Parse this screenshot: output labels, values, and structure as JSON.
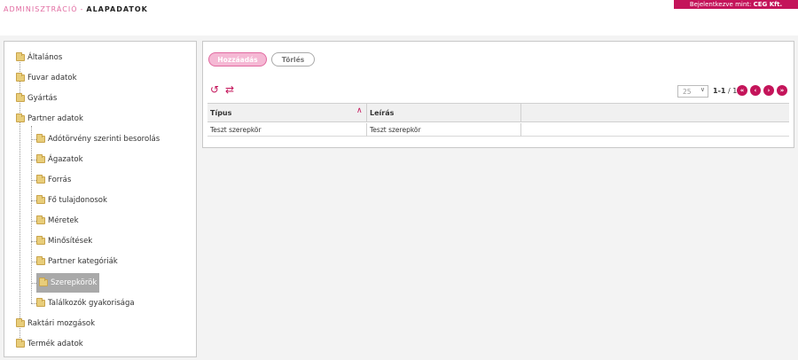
{
  "header": {
    "breadcrumb_root": "ADMINISZTRÁCIÓ",
    "breadcrumb_separator": "-",
    "breadcrumb_current": "ALAPADATOK",
    "login_label": "Bejelentkezve mint:",
    "login_company": "CEG Kft."
  },
  "tree": {
    "items": [
      "Általános",
      "Fuvar adatok",
      "Gyártás",
      "Partner adatok",
      "Adótörvény szerinti besorolás",
      "Ágazatok",
      "Forrás",
      "Fő tulajdonosok",
      "Méretek",
      "Minősítések",
      "Partner kategóriák",
      "Szerepkörök",
      "Találkozók gyakorisága",
      "Raktári mozgások",
      "Termék adatok"
    ],
    "selected": "Szerepkörök"
  },
  "toolbar": {
    "add_label": "Hozzáadás",
    "delete_label": "Törlés"
  },
  "pager": {
    "page_size": "25",
    "range": "1-1",
    "separator": "/",
    "total": "1",
    "first": "«",
    "prev": "‹",
    "next": "›",
    "last": "»"
  },
  "grid": {
    "columns": [
      "Típus",
      "Leírás"
    ],
    "rows": [
      [
        "Teszt szerepkör",
        "Teszt szerepkör"
      ]
    ]
  },
  "colors": {
    "accent": "#c4145a",
    "accent_light": "#f5b8d4",
    "breadcrumb": "#e16aa0"
  },
  "icons": {
    "refresh": "refresh-icon",
    "swap": "swap-icon",
    "tree_node": "folder-icon",
    "sort": "sort-ascending-icon"
  }
}
